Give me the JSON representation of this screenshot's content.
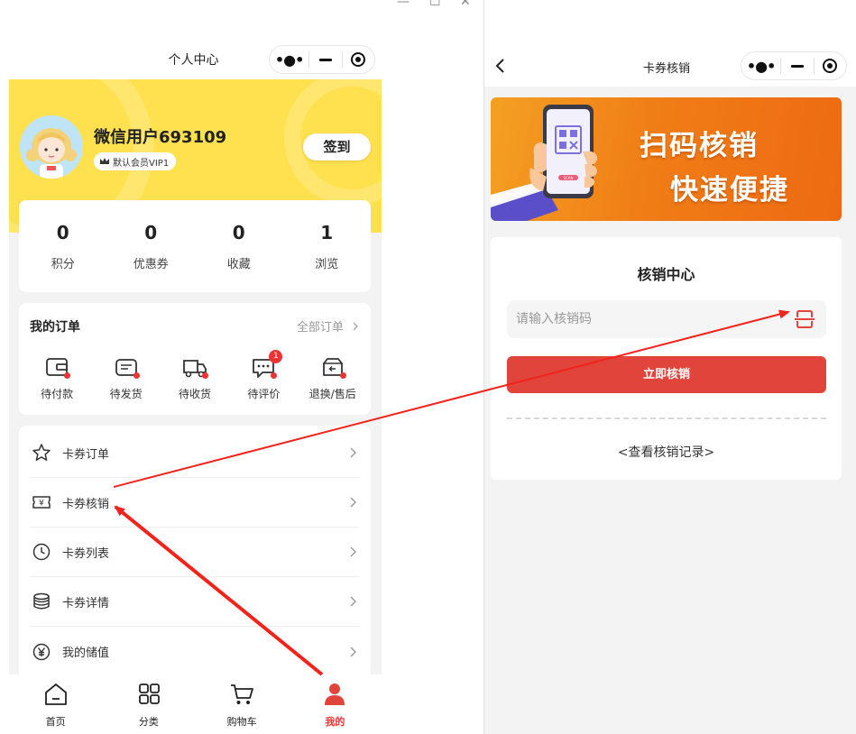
{
  "window": {
    "controls": [
      "—",
      "☐",
      "✕"
    ]
  },
  "left": {
    "nav_title": "个人中心",
    "user": {
      "name": "微信用户693109",
      "vip_label": "默认会员VIP1"
    },
    "signin_label": "签到",
    "stats": [
      {
        "value": "0",
        "label": "积分"
      },
      {
        "value": "0",
        "label": "优惠券"
      },
      {
        "value": "0",
        "label": "收藏"
      },
      {
        "value": "1",
        "label": "浏览"
      }
    ],
    "orders": {
      "title": "我的订单",
      "all_label": "全部订单",
      "items": [
        {
          "label": "待付款",
          "icon": "wallet-icon"
        },
        {
          "label": "待发货",
          "icon": "box-icon"
        },
        {
          "label": "待收货",
          "icon": "truck-icon"
        },
        {
          "label": "待评价",
          "icon": "comment-icon",
          "badge": "1"
        },
        {
          "label": "退换/售后",
          "icon": "return-icon"
        }
      ]
    },
    "menu": [
      {
        "label": "卡券订单",
        "icon": "star-icon"
      },
      {
        "label": "卡券核销",
        "icon": "ticket-icon"
      },
      {
        "label": "卡券列表",
        "icon": "clock-icon"
      },
      {
        "label": "卡券详情",
        "icon": "coins-icon"
      },
      {
        "label": "我的储值",
        "icon": "yuan-icon"
      }
    ],
    "tabs": [
      {
        "label": "首页",
        "icon": "home-icon"
      },
      {
        "label": "分类",
        "icon": "grid-icon"
      },
      {
        "label": "购物车",
        "icon": "cart-icon"
      },
      {
        "label": "我的",
        "icon": "user-icon",
        "active": true
      }
    ]
  },
  "right": {
    "nav_title": "卡券核销",
    "banner": {
      "line1": "扫码核销",
      "line2": "快速便捷",
      "phone_badge": "SCAN"
    },
    "verify": {
      "title": "核销中心",
      "input_placeholder": "请输入核销码",
      "submit_label": "立即核销",
      "records_link": "<查看核销记录>"
    }
  },
  "colors": {
    "accent_red": "#e0443a",
    "header_yellow": "#ffe14f",
    "banner_orange": "#f07d16"
  }
}
